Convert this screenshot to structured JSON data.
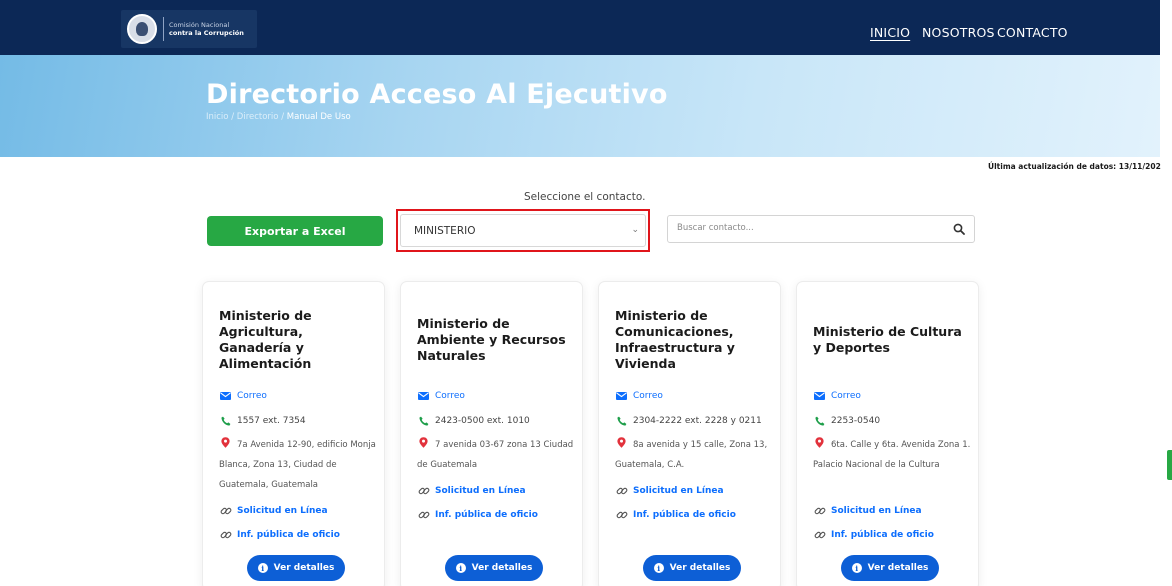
{
  "header": {
    "logo_line1": "Comisión Nacional",
    "logo_line2": "contra la Corrupción",
    "nav": [
      {
        "label": "INICIO",
        "active": true
      },
      {
        "label": "NOSOTROS",
        "active": false
      },
      {
        "label": "CONTACTO",
        "active": false
      }
    ]
  },
  "hero": {
    "title": "Directorio Acceso Al Ejecutivo",
    "breadcrumb": [
      "Inicio",
      "Directorio",
      "Manual De Uso"
    ]
  },
  "updated_text": "Última actualización de datos: 13/11/202",
  "controls": {
    "select_label": "Seleccione el contacto.",
    "export_label": "Exportar a Excel",
    "select_value": "MINISTERIO",
    "search_placeholder": "Buscar contacto..."
  },
  "cards": [
    {
      "title": "Ministerio de Agricultura, Ganadería y Alimentación",
      "email_label": "Correo",
      "phone": "1557 ext. 7354",
      "address": "7a Avenida 12-90, edificio Monja Blanca, Zona 13, Ciudad de Guatemala, Guatemala",
      "online_label": "Solicitud en Línea",
      "info_label": "Inf. pública de oficio",
      "details_label": "Ver detalles"
    },
    {
      "title": "Ministerio de Ambiente y Recursos Naturales",
      "email_label": "Correo",
      "phone": "2423-0500 ext. 1010",
      "address": "7 avenida 03-67 zona 13 Ciudad de Guatemala",
      "online_label": "Solicitud en Línea",
      "info_label": "Inf. pública de oficio",
      "details_label": "Ver detalles"
    },
    {
      "title": "Ministerio de Comunicaciones, Infraestructura y Vivienda",
      "email_label": "Correo",
      "phone": "2304-2222 ext. 2228 y 0211",
      "address": "8a avenida y 15 calle, Zona 13, Guatemala, C.A.",
      "online_label": "Solicitud en Línea",
      "info_label": "Inf. pública de oficio",
      "details_label": "Ver detalles"
    },
    {
      "title": "Ministerio de Cultura y Deportes",
      "email_label": "Correo",
      "phone": "2253-0540",
      "address": "6ta. Calle y 6ta. Avenida Zona 1. Palacio Nacional de la Cultura",
      "online_label": "Solicitud en Línea",
      "info_label": "Inf. pública de oficio",
      "details_label": "Ver detalles"
    }
  ],
  "colors": {
    "navbar": "#0c2856",
    "export_green": "#27a844",
    "link_blue": "#0d6efd",
    "button_blue": "#0d5fd6",
    "highlight_red": "#e0151b"
  }
}
